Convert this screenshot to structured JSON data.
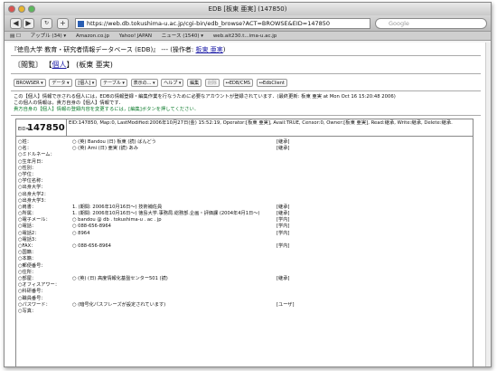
{
  "window": {
    "title": "EDB [板東 亜実] (147850)"
  },
  "toolbar": {
    "back": "◀",
    "forward": "▶",
    "add": "+",
    "url": "https://web.db.tokushima-u.ac.jp/cgi-bin/edb_browse?ACT=BROWSE&EID=147850",
    "search_placeholder": "Google"
  },
  "bookmarks": [
    "アップル (34) ▾",
    "Amazon.co.jp",
    "Yahoo! JAPAN",
    "ニュース (1540) ▾",
    "web.ait230.t...ima-u.ac.jp"
  ],
  "header": {
    "title": "『徳島大学 教育・研究者情報データベース (EDB)』 --- (操作者:",
    "operator": "板東 亜実",
    "title_end": ")",
    "nav_open": "〔閲覧〕",
    "nav_kind": "【",
    "nav_kind_link": "個人",
    "nav_kind_close": "】",
    "nav_name": "(板東 亜実)"
  },
  "buttons": [
    "BROWSER ▾",
    "データ ▾",
    "[個人] ▾",
    "テーブル ▾",
    "表示の... ▾",
    "ヘルプ ▾",
    "編集",
    "削除",
    "↔EDB/CMS",
    "↔EdbClient"
  ],
  "info": {
    "line1": "この【個人】情報で示される個人には，EDBの情報登録・編集作業を行なうために必要なアカウントが登録されています．(最終更新: 板東 亜実 at Mon Oct 16 15:20:48 2006)",
    "line2": "この個人の情報は，貴方自身の【個人】情報です．",
    "line3": "貴方自身の【個人】情報の登録内容を変更するには，[編集]ボタンを押してください．"
  },
  "record": {
    "eid_label": "EID=",
    "eid": "147850",
    "meta": "EID:147850, Map:0, LastModified:2006年10月27日(金) 15:52:19, Operator:[板東 亜実], Avail:TRUE, Censor:0, Owner:[板東 亜実], Read:継承, Write:継承, Delete:継承."
  },
  "fields": [
    {
      "label": "○姓：",
      "value": "○ (英) Bandou (日) 板東 (読) ばんどう",
      "tag": "[継承]"
    },
    {
      "label": "○名：",
      "value": "○ (英) Ami (日) 亜実 (読) あみ",
      "tag": "[継承]"
    },
    {
      "label": "○ミドルネーム：",
      "value": "",
      "tag": ""
    },
    {
      "label": "○生年月日：",
      "value": "",
      "tag": ""
    },
    {
      "label": "○性別：",
      "value": "",
      "tag": ""
    },
    {
      "label": "○学位：",
      "value": "",
      "tag": ""
    },
    {
      "label": "○学位名称：",
      "value": "",
      "tag": ""
    },
    {
      "label": "○出身大学：",
      "value": "",
      "tag": ""
    },
    {
      "label": "○出身大学2：",
      "value": "",
      "tag": ""
    },
    {
      "label": "○出身大学3：",
      "value": "",
      "tag": ""
    },
    {
      "label": "○肩書：",
      "value": "1. (期間: 2006年10月16日〜) 技術補佐員",
      "tag": "[継承]"
    },
    {
      "label": "○所属：",
      "value": "1. (期間: 2006年10月16日〜) 徳島大学.事務局.総務部.企画・評価課 (2004年4月1日〜)",
      "tag": "[継承]"
    },
    {
      "label": "○電子メール：",
      "value": "○ bandou @ db . tokushima-u . ac . jp",
      "tag": "[学内]"
    },
    {
      "label": "○電話：",
      "value": "○ 088-656-8964",
      "tag": "[学内]"
    },
    {
      "label": "○電話2：",
      "value": "○ 8964",
      "tag": "[学内]"
    },
    {
      "label": "○電話3：",
      "value": "",
      "tag": ""
    },
    {
      "label": "○FAX：",
      "value": "○ 088-656-8964",
      "tag": "[学内]"
    },
    {
      "label": "○国籍：",
      "value": "",
      "tag": ""
    },
    {
      "label": "○本籍：",
      "value": "",
      "tag": ""
    },
    {
      "label": "○郵便番号：",
      "value": "",
      "tag": ""
    },
    {
      "label": "○住所：",
      "value": "",
      "tag": ""
    },
    {
      "label": "○部屋：",
      "value": "○ (英) (日) 高度情報化基盤センター501 (読)",
      "tag": "[継承]"
    },
    {
      "label": "○オフィスアワー：",
      "value": "",
      "tag": ""
    },
    {
      "label": "○科研番号：",
      "value": "",
      "tag": ""
    },
    {
      "label": "○職員番号：",
      "value": "",
      "tag": ""
    },
    {
      "label": "○パスワード：",
      "value": "○ (暗号化パスフレーズが設定されています)",
      "tag": "[ユーザ]"
    },
    {
      "label": "○写真：",
      "value": "",
      "tag": ""
    }
  ]
}
